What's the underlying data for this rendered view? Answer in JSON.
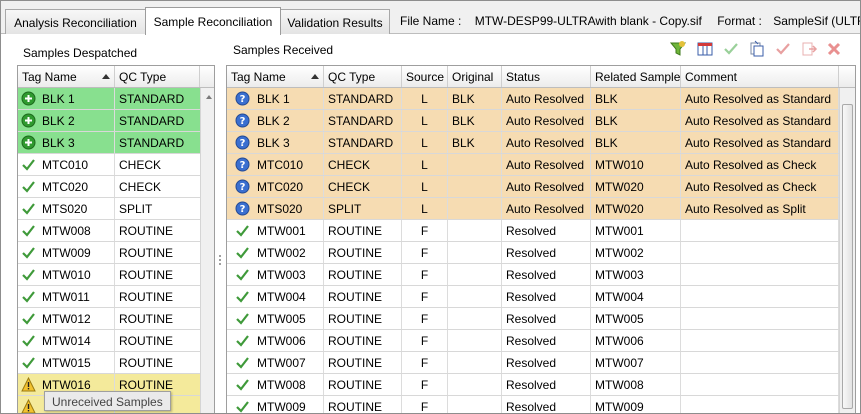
{
  "tabs": [
    {
      "label": "Analysis Reconciliation",
      "active": false
    },
    {
      "label": "Sample Reconciliation",
      "active": true
    },
    {
      "label": "Validation Results",
      "active": false
    }
  ],
  "file_info": {
    "file_name_label": "File Name :",
    "file_name": "MTW-DESP99-ULTRAwith blank - Copy.sif",
    "format_label": "Format :",
    "format": "SampleSif (ULTRA)"
  },
  "despatched": {
    "title": "Samples Despatched",
    "columns": [
      "Tag Name",
      "QC Type"
    ],
    "sorted_column": "Tag Name",
    "rows": [
      {
        "tag": "BLK 1",
        "qc": "STANDARD",
        "state": "added",
        "bg": "#88e08f"
      },
      {
        "tag": "BLK 2",
        "qc": "STANDARD",
        "state": "added",
        "bg": "#88e08f"
      },
      {
        "tag": "BLK 3",
        "qc": "STANDARD",
        "state": "added",
        "bg": "#88e08f"
      },
      {
        "tag": "MTC010",
        "qc": "CHECK",
        "state": "ok",
        "bg": "#ffffff"
      },
      {
        "tag": "MTC020",
        "qc": "CHECK",
        "state": "ok",
        "bg": "#ffffff"
      },
      {
        "tag": "MTS020",
        "qc": "SPLIT",
        "state": "ok",
        "bg": "#ffffff"
      },
      {
        "tag": "MTW008",
        "qc": "ROUTINE",
        "state": "ok",
        "bg": "#ffffff"
      },
      {
        "tag": "MTW009",
        "qc": "ROUTINE",
        "state": "ok",
        "bg": "#ffffff"
      },
      {
        "tag": "MTW010",
        "qc": "ROUTINE",
        "state": "ok",
        "bg": "#ffffff"
      },
      {
        "tag": "MTW011",
        "qc": "ROUTINE",
        "state": "ok",
        "bg": "#ffffff"
      },
      {
        "tag": "MTW012",
        "qc": "ROUTINE",
        "state": "ok",
        "bg": "#ffffff"
      },
      {
        "tag": "MTW014",
        "qc": "ROUTINE",
        "state": "ok",
        "bg": "#ffffff"
      },
      {
        "tag": "MTW015",
        "qc": "ROUTINE",
        "state": "ok",
        "bg": "#ffffff"
      },
      {
        "tag": "MTW016",
        "qc": "ROUTINE",
        "state": "warning",
        "bg": "#f4ea9b"
      },
      {
        "tag": "",
        "qc": "",
        "state": "warning",
        "bg": "#f4ea9b"
      }
    ]
  },
  "received": {
    "title": "Samples Received",
    "toolbar": [
      "filter-icon",
      "column-chooser-icon",
      "accept-icon",
      "copy-icon",
      "reject-icon",
      "export-icon",
      "delete-icon"
    ],
    "columns": [
      "Tag Name",
      "QC Type",
      "Source",
      "Original",
      "Status",
      "Related Sample",
      "Comment"
    ],
    "sorted_column": "Tag Name",
    "rows": [
      {
        "tag": "BLK 1",
        "qc": "STANDARD",
        "source": "L",
        "original": "BLK",
        "status": "Auto Resolved",
        "related": "BLK",
        "comment": "Auto Resolved as Standard",
        "state": "question",
        "bg": "#f6dcb2"
      },
      {
        "tag": "BLK 2",
        "qc": "STANDARD",
        "source": "L",
        "original": "BLK",
        "status": "Auto Resolved",
        "related": "BLK",
        "comment": "Auto Resolved as Standard",
        "state": "question",
        "bg": "#f6dcb2"
      },
      {
        "tag": "BLK 3",
        "qc": "STANDARD",
        "source": "L",
        "original": "BLK",
        "status": "Auto Resolved",
        "related": "BLK",
        "comment": "Auto Resolved as Standard",
        "state": "question",
        "bg": "#f6dcb2"
      },
      {
        "tag": "MTC010",
        "qc": "CHECK",
        "source": "L",
        "original": "",
        "status": "Auto Resolved",
        "related": "MTW010",
        "comment": "Auto Resolved as Check",
        "state": "question",
        "bg": "#f6dcb2"
      },
      {
        "tag": "MTC020",
        "qc": "CHECK",
        "source": "L",
        "original": "",
        "status": "Auto Resolved",
        "related": "MTW020",
        "comment": "Auto Resolved as Check",
        "state": "question",
        "bg": "#f6dcb2"
      },
      {
        "tag": "MTS020",
        "qc": "SPLIT",
        "source": "L",
        "original": "",
        "status": "Auto Resolved",
        "related": "MTW020",
        "comment": "Auto Resolved as Split",
        "state": "question",
        "bg": "#f6dcb2"
      },
      {
        "tag": "MTW001",
        "qc": "ROUTINE",
        "source": "F",
        "original": "",
        "status": "Resolved",
        "related": "MTW001",
        "comment": "",
        "state": "ok",
        "bg": "#ffffff"
      },
      {
        "tag": "MTW002",
        "qc": "ROUTINE",
        "source": "F",
        "original": "",
        "status": "Resolved",
        "related": "MTW002",
        "comment": "",
        "state": "ok",
        "bg": "#ffffff"
      },
      {
        "tag": "MTW003",
        "qc": "ROUTINE",
        "source": "F",
        "original": "",
        "status": "Resolved",
        "related": "MTW003",
        "comment": "",
        "state": "ok",
        "bg": "#ffffff"
      },
      {
        "tag": "MTW004",
        "qc": "ROUTINE",
        "source": "F",
        "original": "",
        "status": "Resolved",
        "related": "MTW004",
        "comment": "",
        "state": "ok",
        "bg": "#ffffff"
      },
      {
        "tag": "MTW005",
        "qc": "ROUTINE",
        "source": "F",
        "original": "",
        "status": "Resolved",
        "related": "MTW005",
        "comment": "",
        "state": "ok",
        "bg": "#ffffff"
      },
      {
        "tag": "MTW006",
        "qc": "ROUTINE",
        "source": "F",
        "original": "",
        "status": "Resolved",
        "related": "MTW006",
        "comment": "",
        "state": "ok",
        "bg": "#ffffff"
      },
      {
        "tag": "MTW007",
        "qc": "ROUTINE",
        "source": "F",
        "original": "",
        "status": "Resolved",
        "related": "MTW007",
        "comment": "",
        "state": "ok",
        "bg": "#ffffff"
      },
      {
        "tag": "MTW008",
        "qc": "ROUTINE",
        "source": "F",
        "original": "",
        "status": "Resolved",
        "related": "MTW008",
        "comment": "",
        "state": "ok",
        "bg": "#ffffff"
      },
      {
        "tag": "MTW009",
        "qc": "ROUTINE",
        "source": "F",
        "original": "",
        "status": "Resolved",
        "related": "MTW009",
        "comment": "",
        "state": "ok",
        "bg": "#ffffff"
      }
    ]
  },
  "tooltip": "Unreceived Samples"
}
